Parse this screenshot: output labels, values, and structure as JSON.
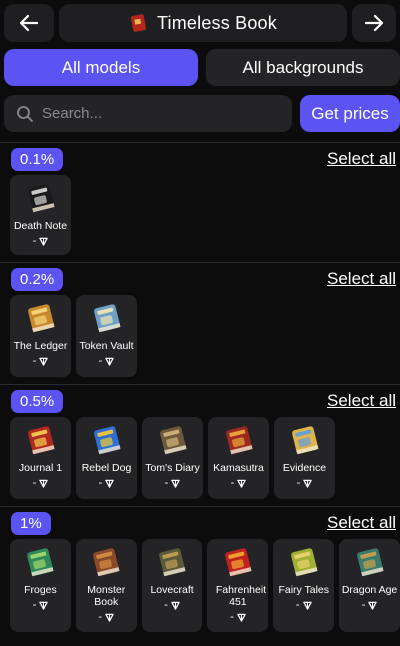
{
  "header": {
    "title": "Timeless Book",
    "back_icon": "arrow-left-icon",
    "forward_icon": "arrow-right-icon"
  },
  "tabs": {
    "models_label": "All models",
    "backgrounds_label": "All backgrounds"
  },
  "search": {
    "placeholder": "Search...",
    "get_prices_label": "Get prices"
  },
  "colors": {
    "accent": "#5b53f2",
    "panel": "#242426",
    "background": "#0c0c0d"
  },
  "sections": [
    {
      "rarity": "0.1%",
      "select_all": "Select all",
      "items": [
        {
          "name": "Death Note",
          "price": "-"
        }
      ]
    },
    {
      "rarity": "0.2%",
      "select_all": "Select all",
      "items": [
        {
          "name": "The Ledger",
          "price": "-"
        },
        {
          "name": "Token Vault",
          "price": "-"
        }
      ]
    },
    {
      "rarity": "0.5%",
      "select_all": "Select all",
      "items": [
        {
          "name": "Journal 1",
          "price": "-"
        },
        {
          "name": "Rebel Dog",
          "price": "-"
        },
        {
          "name": "Tom's Diary",
          "price": "-"
        },
        {
          "name": "Kamasutra",
          "price": "-"
        },
        {
          "name": "Evidence",
          "price": "-"
        }
      ]
    },
    {
      "rarity": "1%",
      "select_all": "Select all",
      "items": [
        {
          "name": "Froges",
          "price": "-"
        },
        {
          "name": "Monster Book",
          "price": "-"
        },
        {
          "name": "Lovecraft",
          "price": "-"
        },
        {
          "name": "Fahrenheit 451",
          "price": "-"
        },
        {
          "name": "Fairy Tales",
          "price": "-"
        },
        {
          "name": "Dragon Age",
          "price": "-"
        }
      ]
    }
  ]
}
